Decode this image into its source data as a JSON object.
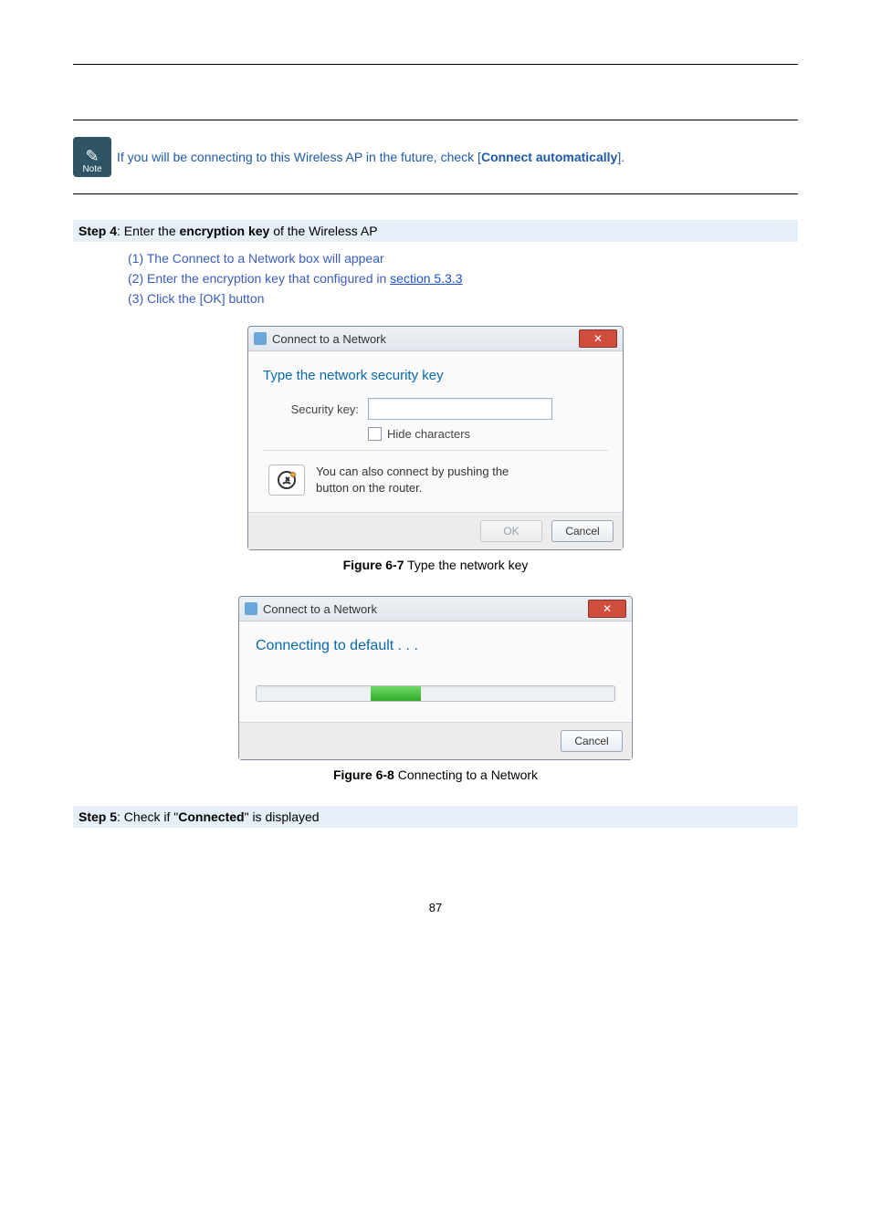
{
  "note": {
    "icon_label": "Note",
    "line_pre": "If you will be connecting to this Wireless AP in the future, check [",
    "bold": "Connect automatically",
    "line_post": "]."
  },
  "step4": {
    "bar_pre": "Step 4",
    "bar_mid": ": Enter the ",
    "bar_bold": "encryption key",
    "bar_post": " of the Wireless AP",
    "items": {
      "i1": "(1)  The Connect to a Network box will appear",
      "i2_pre": "(2)  Enter the encryption key that configured in ",
      "i2_link": "section 5.3.3",
      "i3": "(3)  Click the [OK] button"
    }
  },
  "dialog1": {
    "title": "Connect to a Network",
    "heading": "Type the network security key",
    "sk_label": "Security key:",
    "hide_label": "Hide characters",
    "push_l1": "You can also connect by pushing the",
    "push_l2": "button on the router.",
    "ok": "OK",
    "cancel": "Cancel"
  },
  "fig67": {
    "bold": "Figure 6-7",
    "rest": " Type the network key"
  },
  "dialog2": {
    "title": "Connect to a Network",
    "heading": "Connecting to default . . .",
    "cancel": "Cancel"
  },
  "fig68": {
    "bold": "Figure 6-8",
    "rest": " Connecting to a Network"
  },
  "step5": {
    "bar_pre": "Step 5",
    "bar_mid": ": Check if \"",
    "bar_bold": "Connected",
    "bar_post": "\" is displayed"
  },
  "pagenum": "87"
}
